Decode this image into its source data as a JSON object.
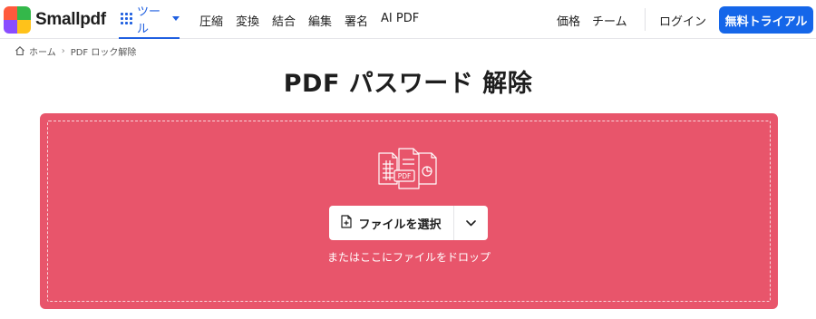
{
  "header": {
    "logo_text": "Smallpdf",
    "logo_colors": [
      "#ff5a3c",
      "#34b84a",
      "#8a4dff",
      "#ffc21a"
    ],
    "tools_label": "ツール",
    "nav_items": [
      "圧縮",
      "変換",
      "結合",
      "編集",
      "署名",
      "AI PDF"
    ],
    "pricing_label": "価格",
    "team_label": "チーム",
    "login_label": "ログイン",
    "trial_label": "無料トライアル"
  },
  "breadcrumb": {
    "home": "ホーム",
    "current": "PDF ロック解除"
  },
  "main": {
    "title": "PDF パスワード 解除"
  },
  "dropzone": {
    "choose_label": "ファイルを選択",
    "drop_text": "またはここにファイルをドロップ",
    "icon_badge": "PDF",
    "bg_color": "#e8556b"
  },
  "colors": {
    "accent": "#1f5fe0",
    "trial_button": "#1566e9"
  }
}
